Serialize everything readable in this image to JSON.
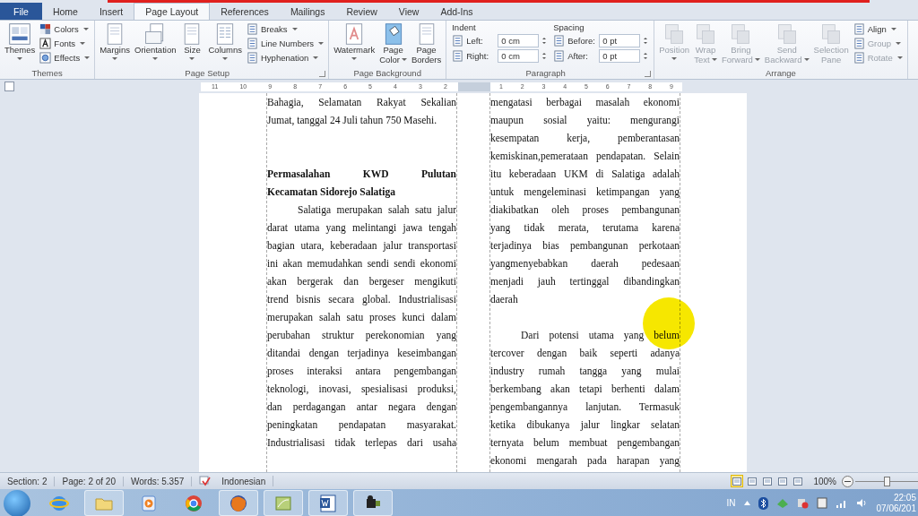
{
  "tabs": [
    {
      "label": "File",
      "kind": "file",
      "selected": false
    },
    {
      "label": "Home",
      "kind": "tab",
      "selected": false
    },
    {
      "label": "Insert",
      "kind": "tab",
      "selected": false
    },
    {
      "label": "Page Layout",
      "kind": "tab",
      "selected": true
    },
    {
      "label": "References",
      "kind": "tab",
      "selected": false
    },
    {
      "label": "Mailings",
      "kind": "tab",
      "selected": false
    },
    {
      "label": "Review",
      "kind": "tab",
      "selected": false
    },
    {
      "label": "View",
      "kind": "tab",
      "selected": false
    },
    {
      "label": "Add-Ins",
      "kind": "tab",
      "selected": false
    }
  ],
  "ribbon": {
    "groups": [
      {
        "title": "Themes",
        "launcher": false,
        "items": [
          {
            "kind": "large",
            "lines": [
              "Themes"
            ],
            "dropdown": true
          },
          {
            "kind": "smallstack",
            "entries": [
              {
                "label": "Colors",
                "dropdown": true
              },
              {
                "label": "Fonts",
                "dropdown": true
              },
              {
                "label": "Effects",
                "dropdown": true
              }
            ]
          }
        ]
      },
      {
        "title": "Page Setup",
        "launcher": true,
        "items": [
          {
            "kind": "large",
            "lines": [
              "Margins"
            ],
            "dropdown": true
          },
          {
            "kind": "large",
            "lines": [
              "Orientation"
            ],
            "dropdown": true
          },
          {
            "kind": "large",
            "lines": [
              "Size"
            ],
            "dropdown": true
          },
          {
            "kind": "large",
            "lines": [
              "Columns"
            ],
            "dropdown": true
          },
          {
            "kind": "smallstack",
            "entries": [
              {
                "label": "Breaks",
                "dropdown": true
              },
              {
                "label": "Line Numbers",
                "dropdown": true
              },
              {
                "label": "Hyphenation",
                "dropdown": true
              }
            ]
          }
        ]
      },
      {
        "title": "Page Background",
        "launcher": false,
        "items": [
          {
            "kind": "large",
            "lines": [
              "Watermark"
            ],
            "dropdown": true
          },
          {
            "kind": "large",
            "lines": [
              "Page",
              "Color"
            ],
            "dropdown": true
          },
          {
            "kind": "large",
            "lines": [
              "Page",
              "Borders"
            ],
            "dropdown": false
          }
        ]
      },
      {
        "title": "Paragraph",
        "launcher": true,
        "items": [
          {
            "kind": "spins",
            "title": "Indent",
            "fields": [
              {
                "label": "Left:",
                "value": "0 cm"
              },
              {
                "label": "Right:",
                "value": "0 cm"
              }
            ]
          },
          {
            "kind": "spins",
            "title": "Spacing",
            "fields": [
              {
                "label": "Before:",
                "value": "0 pt"
              },
              {
                "label": "After:",
                "value": "0 pt"
              }
            ]
          }
        ]
      },
      {
        "title": "Arrange",
        "launcher": false,
        "items": [
          {
            "kind": "large",
            "lines": [
              "Position"
            ],
            "dropdown": true,
            "disabled": true
          },
          {
            "kind": "large",
            "lines": [
              "Wrap",
              "Text"
            ],
            "dropdown": true,
            "disabled": true
          },
          {
            "kind": "large",
            "lines": [
              "Bring",
              "Forward"
            ],
            "dropdown": true,
            "disabled": true
          },
          {
            "kind": "large",
            "lines": [
              "Send",
              "Backward"
            ],
            "dropdown": true,
            "disabled": true
          },
          {
            "kind": "large",
            "lines": [
              "Selection",
              "Pane"
            ],
            "dropdown": false,
            "disabled": true
          },
          {
            "kind": "smallstack",
            "entries": [
              {
                "label": "Align",
                "dropdown": true,
                "disabled": false
              },
              {
                "label": "Group",
                "dropdown": true,
                "disabled": true
              },
              {
                "label": "Rotate",
                "dropdown": true,
                "disabled": true
              }
            ]
          }
        ]
      }
    ]
  },
  "ruler": {
    "left_numbers": [
      "11",
      "10",
      "9",
      "8",
      "7",
      "6",
      "5",
      "4",
      "3",
      "2"
    ],
    "right_numbers": [
      "1",
      "2",
      "3",
      "4",
      "5",
      "6",
      "7",
      "8",
      "9"
    ]
  },
  "document": {
    "columns": [
      {
        "lines": [
          {
            "kind": "line",
            "text": "Bahagia, Selamatan Rakyat Sekalian"
          },
          {
            "kind": "end",
            "text": "Jumat, tanggal 24 Juli tahun 750 Masehi."
          },
          {
            "kind": "blank"
          },
          {
            "kind": "blank"
          },
          {
            "kind": "heading",
            "text": "Permasalahan KWD Pulutan"
          },
          {
            "kind": "heading-end",
            "text": "Kecamatan Sidorejo Salatiga"
          },
          {
            "kind": "indent",
            "text": "Salatiga merupakan salah satu jalur"
          },
          {
            "kind": "line",
            "text": "darat utama yang melintangi jawa tengah"
          },
          {
            "kind": "line",
            "text": "bagian utara, keberadaan jalur transportasi"
          },
          {
            "kind": "line",
            "text": "ini akan memudahkan sendi sendi ekonomi"
          },
          {
            "kind": "line",
            "text": "akan bergerak dan bergeser mengikuti"
          },
          {
            "kind": "line",
            "text": "trend bisnis secara global. Industrialisasi"
          },
          {
            "kind": "line",
            "text": "merupakan salah satu proses kunci dalam"
          },
          {
            "kind": "line",
            "text": "perubahan struktur perekonomian yang"
          },
          {
            "kind": "line",
            "text": "ditandai dengan terjadinya keseimbangan"
          },
          {
            "kind": "line",
            "text": "proses interaksi antara pengembangan"
          },
          {
            "kind": "line",
            "text": "teknologi, inovasi, spesialisasi produksi,"
          },
          {
            "kind": "line",
            "text": "dan perdagangan antar negara dengan"
          },
          {
            "kind": "line",
            "text": "peningkatan pendapatan masyarakat."
          },
          {
            "kind": "line",
            "text": "Industrialisasi tidak terlepas dari usaha"
          }
        ]
      },
      {
        "lines": [
          {
            "kind": "line",
            "text": "mengatasi berbagai masalah ekonomi"
          },
          {
            "kind": "line",
            "text": "maupun sosial yaitu: mengurangi"
          },
          {
            "kind": "line",
            "text": "kesempatan kerja, pemberantasan"
          },
          {
            "kind": "line",
            "text": "kemiskinan,pemerataan pendapatan. Selain"
          },
          {
            "kind": "line",
            "text": "itu keberadaan UKM di Salatiga adalah"
          },
          {
            "kind": "line",
            "text": "untuk mengeleminasi ketimpangan yang"
          },
          {
            "kind": "line",
            "text": "diakibatkan oleh proses pembangunan"
          },
          {
            "kind": "line",
            "text": "yang tidak merata, terutama karena"
          },
          {
            "kind": "line",
            "text": "terjadinya bias pembangunan perkotaan"
          },
          {
            "kind": "line",
            "text": "yangmenyebabkan daerah pedesaan"
          },
          {
            "kind": "line",
            "text": "menjadi jauh tertinggal dibandingkan"
          },
          {
            "kind": "end",
            "text": "daerah"
          },
          {
            "kind": "blank"
          },
          {
            "kind": "indent",
            "text": "Dari potensi utama yang belum"
          },
          {
            "kind": "line",
            "text": "tercover dengan baik seperti adanya"
          },
          {
            "kind": "line",
            "text": "industry rumah tangga yang mulai"
          },
          {
            "kind": "line",
            "text": "berkembang akan tetapi berhenti dalam"
          },
          {
            "kind": "line",
            "text": "pengembangannya lanjutan. Termasuk"
          },
          {
            "kind": "line",
            "text": "ketika dibukanya jalur lingkar selatan"
          },
          {
            "kind": "line",
            "text": "ternyata belum membuat pengembangan"
          },
          {
            "kind": "line",
            "text": "ekonomi mengarah pada harapan yang"
          }
        ]
      }
    ],
    "pointer_highlight": true
  },
  "status_bar": {
    "items": [
      "Section: 2",
      "Page: 2 of 20",
      "Words: 5.357"
    ],
    "language": "Indonesian",
    "views": [
      {
        "selected": true
      },
      {
        "selected": false
      },
      {
        "selected": false
      },
      {
        "selected": false
      },
      {
        "selected": false
      }
    ],
    "zoom": "100%",
    "zoom_slider": {
      "level": 0.5
    }
  },
  "taskbar": {
    "apps": [
      {
        "active": false
      },
      {
        "active": true
      },
      {
        "active": false
      },
      {
        "active": false
      },
      {
        "active": true
      },
      {
        "active": true
      },
      {
        "active": true
      },
      {
        "active": true
      }
    ],
    "language": "IN",
    "time": "22:05",
    "date": "07/06/201"
  }
}
